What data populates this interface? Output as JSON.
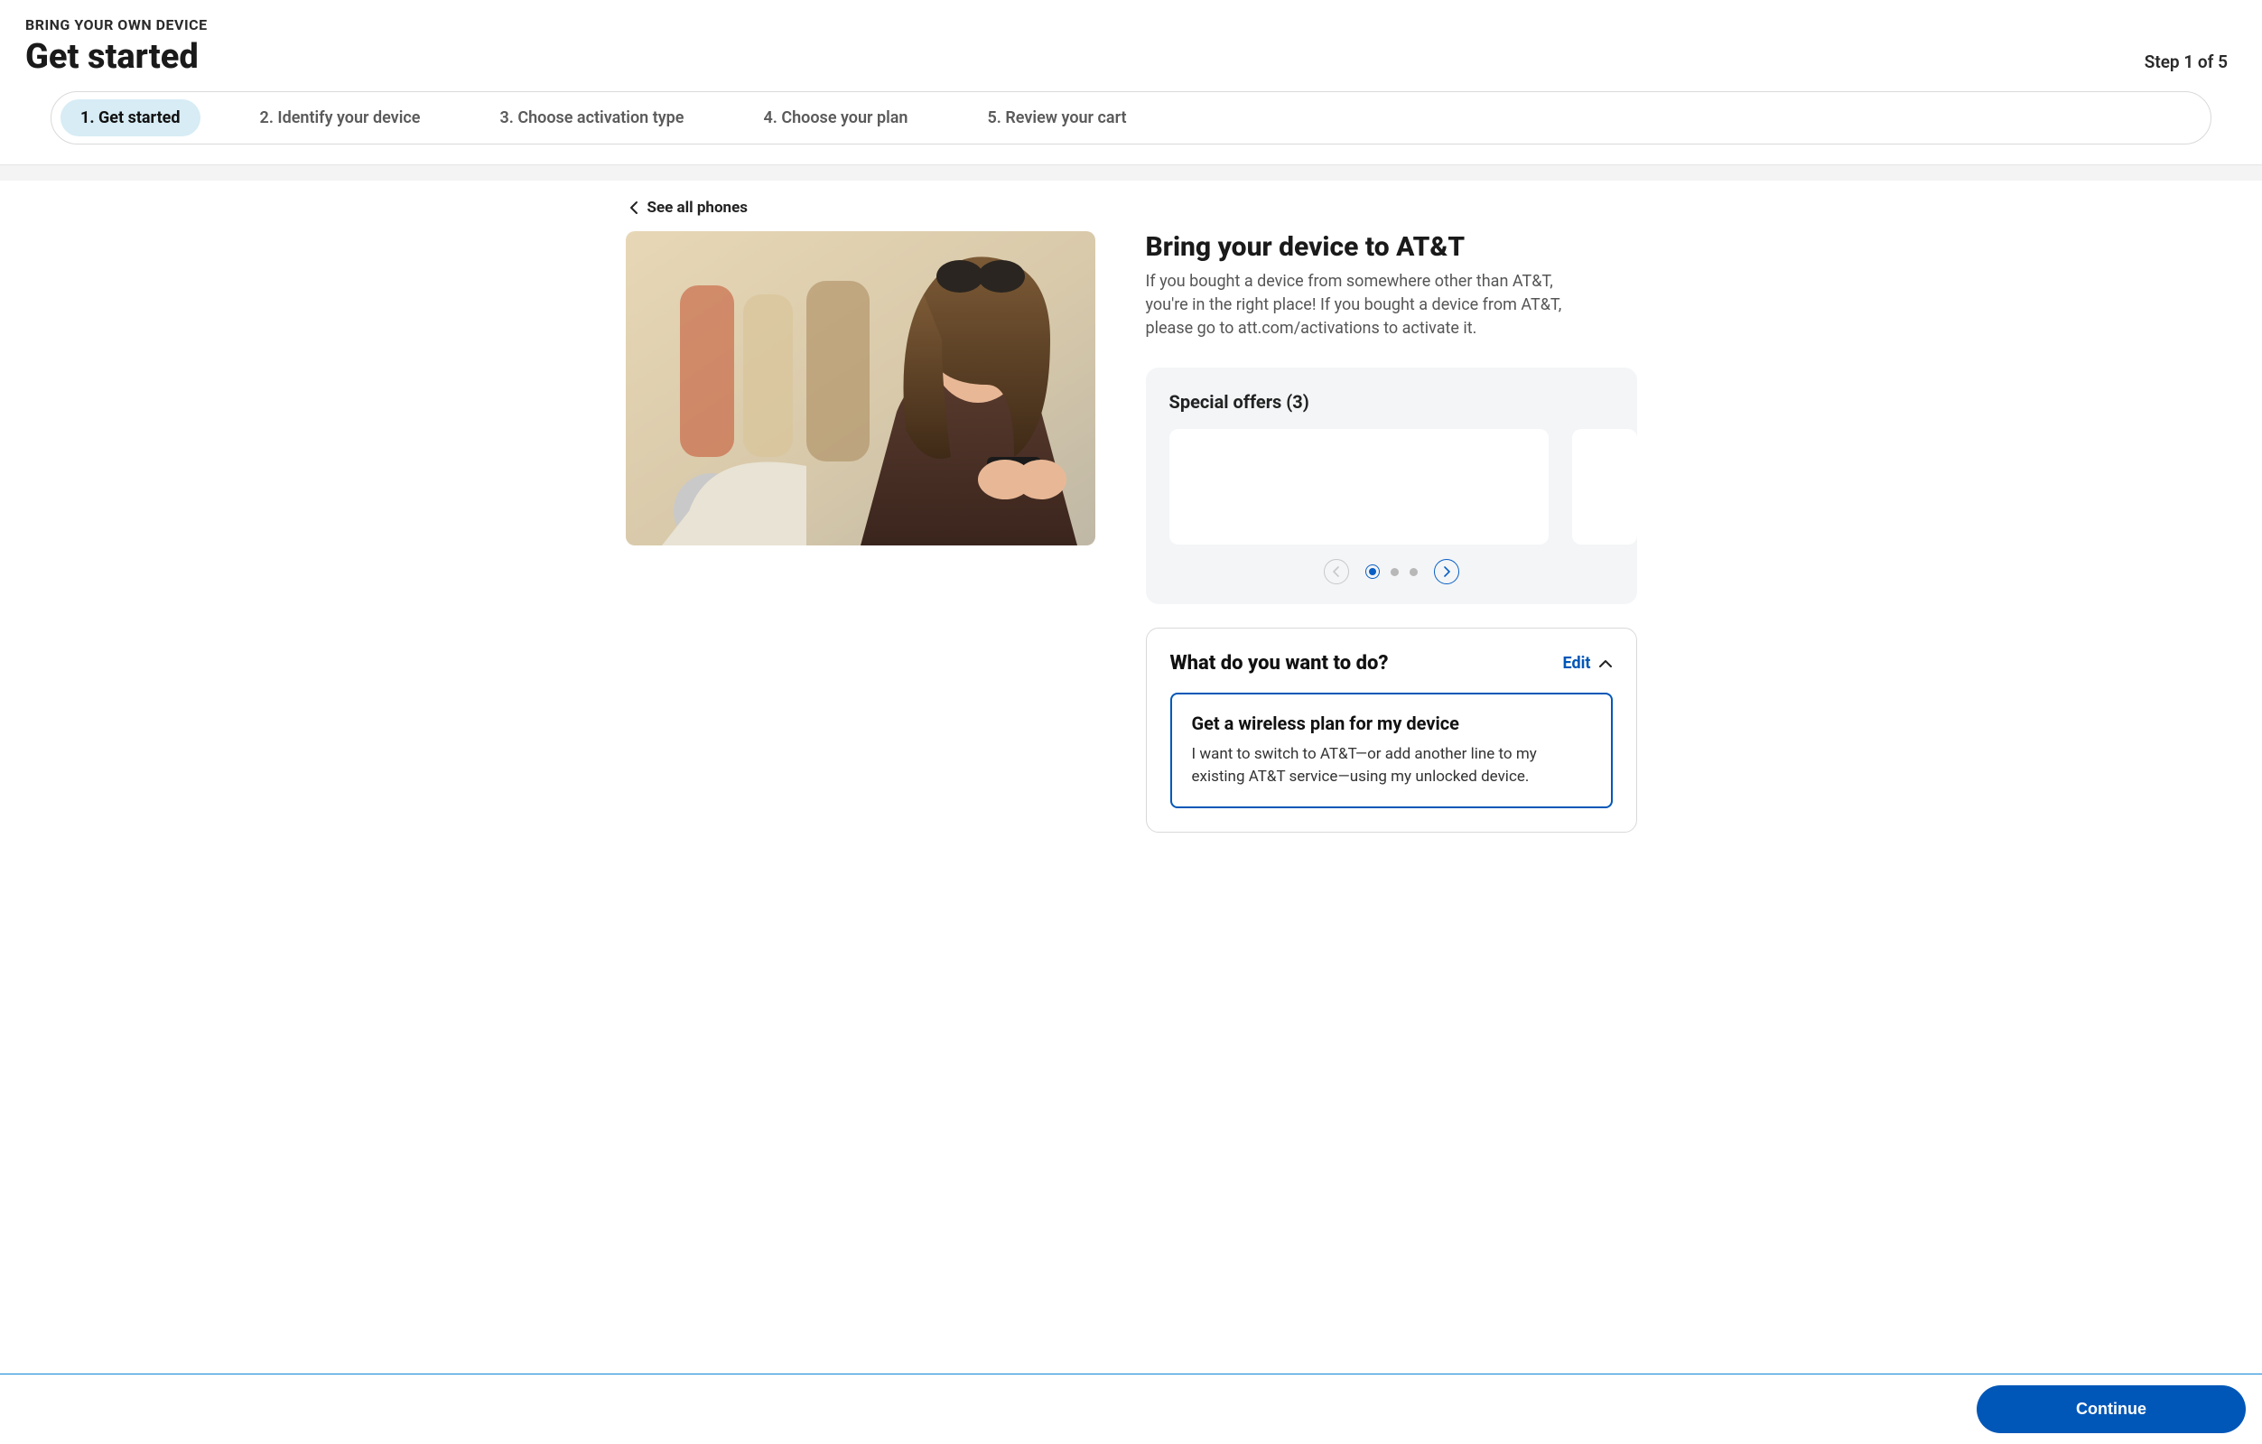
{
  "header": {
    "eyebrow": "BRING YOUR OWN DEVICE",
    "title": "Get started",
    "step_indicator": "Step 1 of 5"
  },
  "stepper": {
    "steps": [
      {
        "label": "1. Get started",
        "active": true
      },
      {
        "label": "2. Identify your device",
        "active": false
      },
      {
        "label": "3. Choose activation type",
        "active": false
      },
      {
        "label": "4. Choose your plan",
        "active": false
      },
      {
        "label": "5. Review your cart",
        "active": false
      }
    ]
  },
  "back_link": {
    "label": "See all phones"
  },
  "intro": {
    "title": "Bring your device to AT&T",
    "desc": "If you bought a device from somewhere other than AT&T, you're in the right place! If you bought a device from AT&T, please go to att.com/activations to activate it."
  },
  "offers": {
    "title": "Special offers (3)",
    "count": 3,
    "active_index": 0
  },
  "question": {
    "title": "What do you want to do?",
    "edit_label": "Edit",
    "option": {
      "title": "Get a wireless plan for my device",
      "desc": "I want to switch to AT&T—or add another line to my existing AT&T service—using my unlocked device."
    }
  },
  "footer": {
    "continue_label": "Continue"
  },
  "colors": {
    "accent": "#0057b8",
    "pill_bg": "#d7ecf5",
    "muted_bg": "#f3f5f7"
  }
}
